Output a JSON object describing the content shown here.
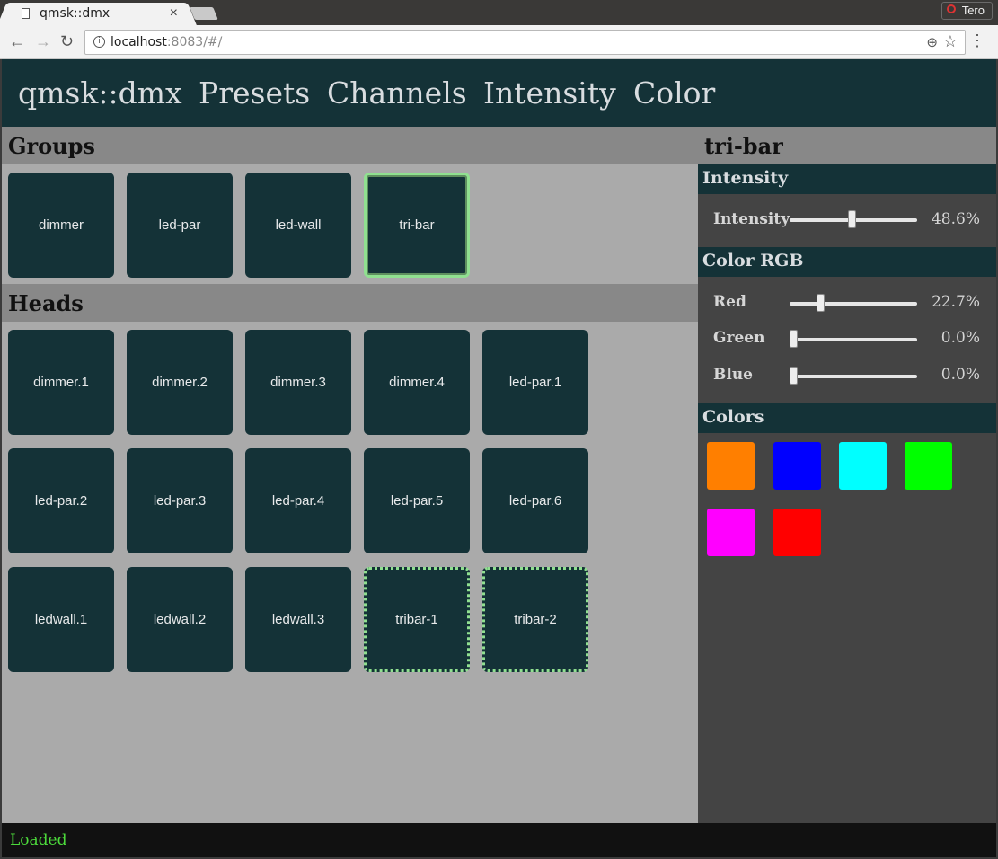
{
  "browser": {
    "tab_title": "qmsk::dmx",
    "tab_close": "×",
    "profile_name": "Tero",
    "url_host": "localhost",
    "url_rest": ":8083/#/",
    "back_glyph": "←",
    "forward_glyph": "→",
    "reload_glyph": "↻",
    "info_glyph": "i",
    "zoom_glyph": "⊕",
    "star_glyph": "☆",
    "menu_glyph": "⋮"
  },
  "navbar": {
    "brand": "qmsk::dmx",
    "items": [
      "Presets",
      "Channels",
      "Intensity",
      "Color"
    ]
  },
  "groups": {
    "title": "Groups",
    "items": [
      {
        "label": "dimmer",
        "state": "normal"
      },
      {
        "label": "led-par",
        "state": "normal"
      },
      {
        "label": "led-wall",
        "state": "normal"
      },
      {
        "label": "tri-bar",
        "state": "selected"
      }
    ]
  },
  "heads": {
    "title": "Heads",
    "rows": [
      [
        "dimmer.1",
        "dimmer.2",
        "dimmer.3",
        "dimmer.4",
        "led-par.1"
      ],
      [
        "led-par.2",
        "led-par.3",
        "led-par.4",
        "led-par.5",
        "led-par.6"
      ],
      [
        "ledwall.1",
        "ledwall.2",
        "ledwall.3",
        "tribar-1",
        "tribar-2"
      ]
    ],
    "highlighted": [
      "tribar-1",
      "tribar-2"
    ]
  },
  "panel": {
    "title": "tri-bar",
    "intensity": {
      "header": "Intensity",
      "sliders": [
        {
          "label": "Intensity",
          "value": 0.486,
          "value_text": "48.6%"
        }
      ]
    },
    "color_rgb": {
      "header": "Color RGB",
      "sliders": [
        {
          "label": "Red",
          "value": 0.227,
          "value_text": "22.7%"
        },
        {
          "label": "Green",
          "value": 0.0,
          "value_text": "0.0%"
        },
        {
          "label": "Blue",
          "value": 0.0,
          "value_text": "0.0%"
        }
      ]
    },
    "colors": {
      "header": "Colors",
      "swatches": [
        "#ff7f00",
        "#0000ff",
        "#00ffff",
        "#00ff00",
        "#ff00ff",
        "#ff0000"
      ]
    }
  },
  "colors": {
    "navbar_bg": "#143237",
    "tile_bg": "#143237",
    "selected_border": "#90e090",
    "status_text": "#4ddc3c"
  },
  "status": {
    "text": "Loaded"
  }
}
